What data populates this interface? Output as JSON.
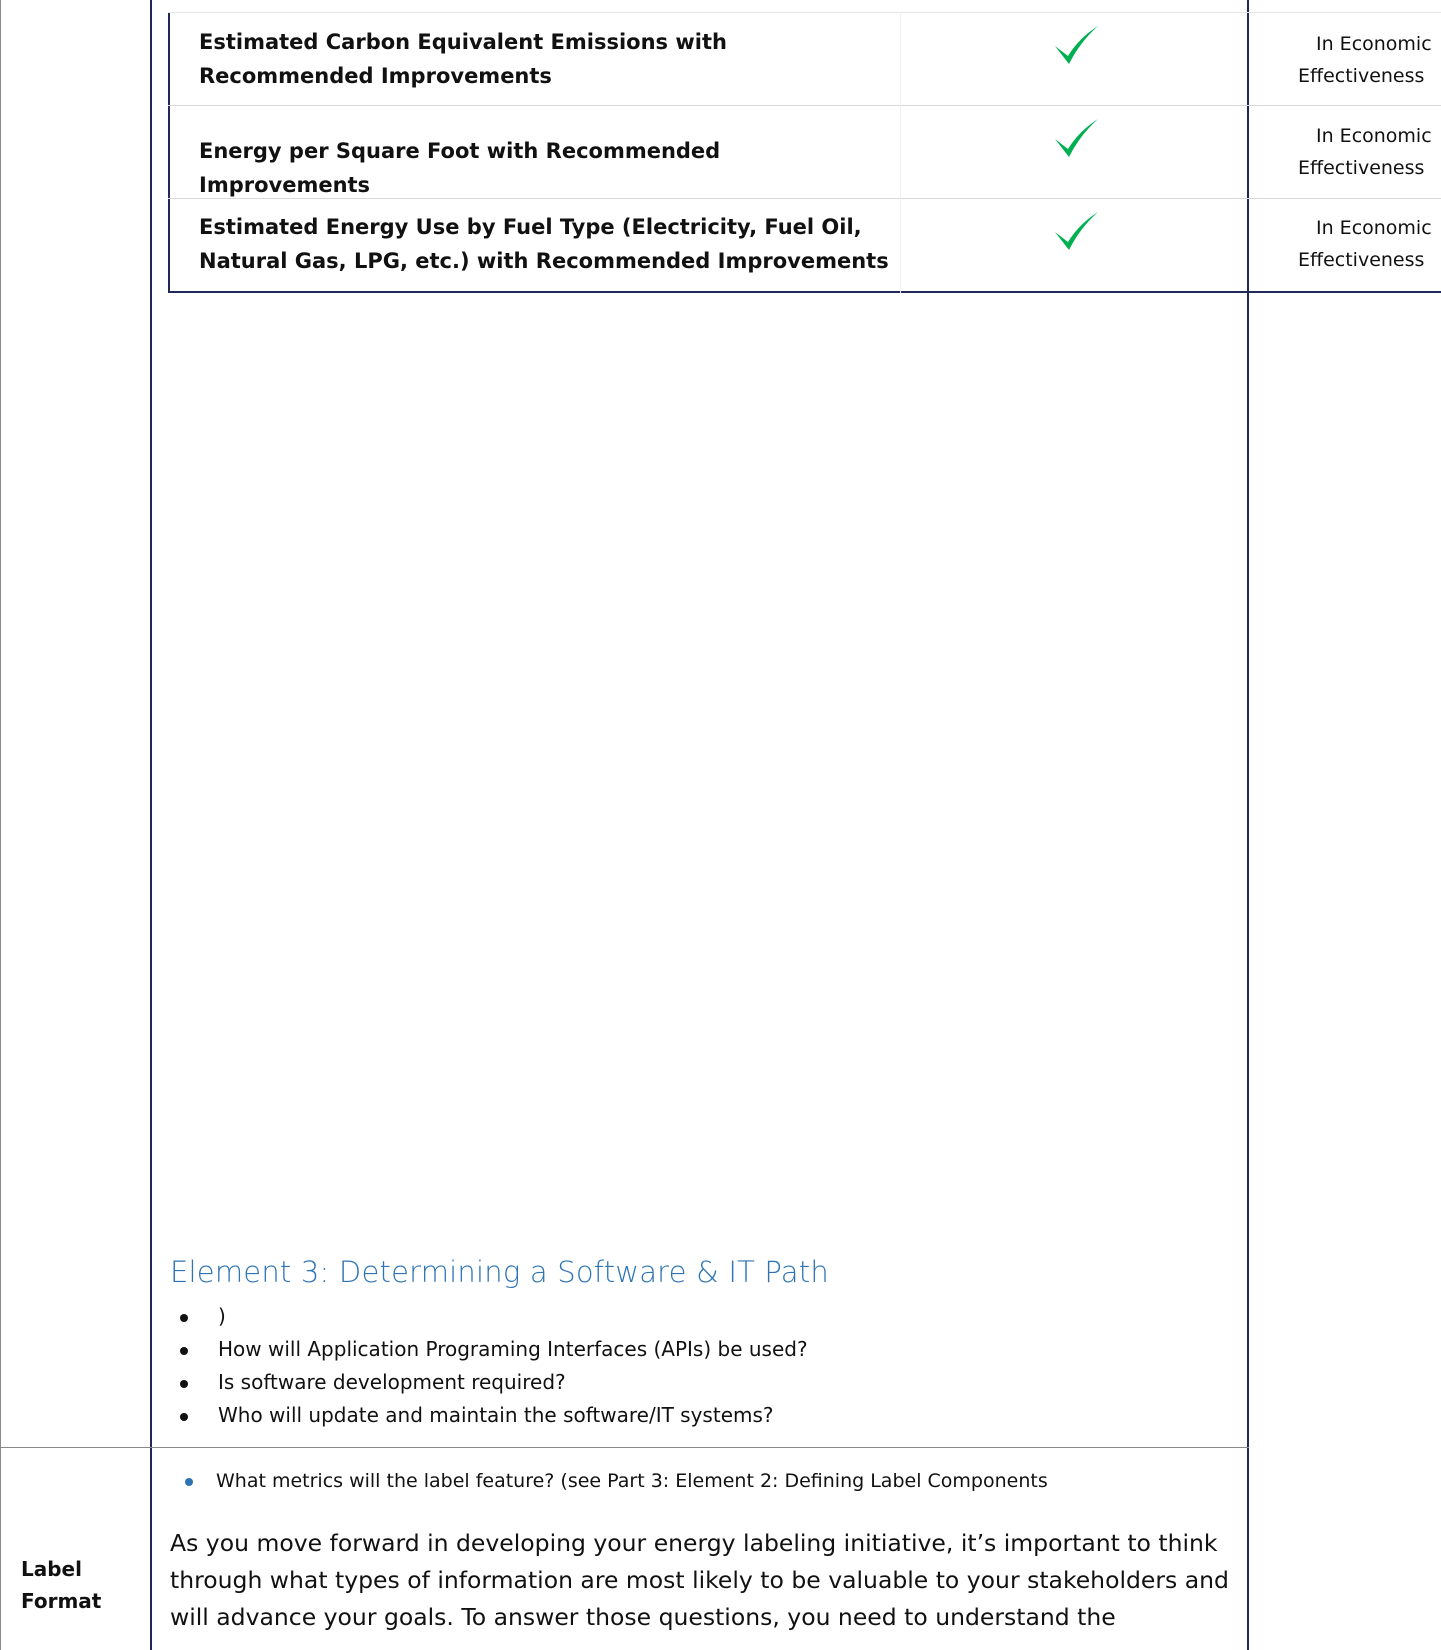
{
  "table": {
    "rows": [
      {
        "text": "Estimated Carbon Equivalent Emissions with Recommended Improvements",
        "right_line1": "In Economic",
        "right_line2": "Effectiveness"
      },
      {
        "text": "Energy per Square Foot with Recommended Improvements",
        "right_line1": "In Economic",
        "right_line2": "Effectiveness"
      },
      {
        "text": "Estimated Energy Use by Fuel Type (Electricity, Fuel Oil, Natural Gas, LPG, etc.) with Recommended Improvements",
        "right_line1": "In Economic",
        "right_line2": "Effectiveness"
      }
    ],
    "check_icon": "checkmark-icon",
    "check_color": "#00b050"
  },
  "section": {
    "heading": "Element 3: Determining a Software & IT Path",
    "bullets": [
      ")",
      "How will Application Programing Interfaces (APIs) be used?",
      "Is software development required?",
      "Who will update and maintain the software/IT systems?"
    ]
  },
  "label_format": {
    "side_label_line1": "Label",
    "side_label_line2": "Format",
    "metric_bullet": "What metrics will the label feature? (see Part 3: Element 2: Defining Label Components",
    "paragraph": "As you move forward in developing your energy labeling initiative, it’s important to think through what types of information are most likely to be valuable to your stakeholders and will advance your goals. To answer those questions, you need to understand the"
  },
  "colors": {
    "border": "#1f2a5a",
    "heading": "#2e74b5",
    "metric_bullet": "#2e74b5"
  }
}
